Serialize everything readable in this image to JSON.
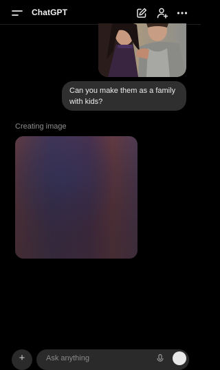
{
  "header": {
    "title": "ChatGPT",
    "icons": [
      "menu-icon",
      "new-chat-icon",
      "add-person-icon",
      "more-icon"
    ]
  },
  "conversation": {
    "user_message": "Can you make them as a family with kids?",
    "assistant_status": "Creating image"
  },
  "composer": {
    "plus_label": "+",
    "placeholder": "Ask anything",
    "icons": [
      "plus-icon",
      "mic-icon",
      "voice-mode-icon"
    ]
  },
  "colors": {
    "background": "#000000",
    "bubble": "#2f2f2f",
    "text_primary": "#ececec",
    "text_muted": "#8e8e8e"
  }
}
